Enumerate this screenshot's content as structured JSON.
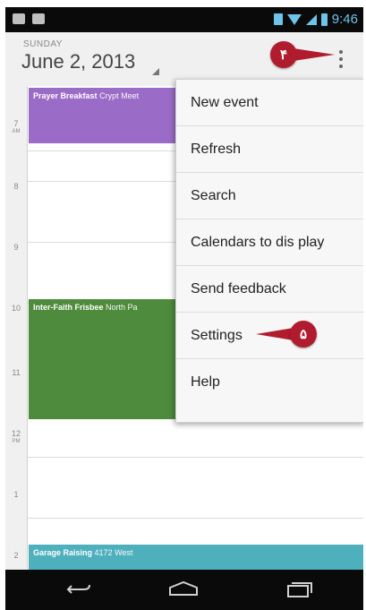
{
  "status_bar": {
    "time": "9:46",
    "icons": [
      "email-icon",
      "game-icon",
      "bluetooth-icon",
      "wifi-icon",
      "signal-icon",
      "battery-icon"
    ]
  },
  "header": {
    "day": "SUNDAY",
    "date": "June 2, 2013"
  },
  "time_labels": [
    {
      "hour": "7",
      "ampm": "AM"
    },
    {
      "hour": "8",
      "ampm": ""
    },
    {
      "hour": "9",
      "ampm": ""
    },
    {
      "hour": "10",
      "ampm": ""
    },
    {
      "hour": "11",
      "ampm": ""
    },
    {
      "hour": "12",
      "ampm": "PM"
    },
    {
      "hour": "1",
      "ampm": ""
    },
    {
      "hour": "2",
      "ampm": ""
    }
  ],
  "events": [
    {
      "title": "Prayer Breakfast",
      "location": "Crypt Meet",
      "color": "#9b6cc7"
    },
    {
      "title": "Inter-Faith Frisbee",
      "location": "North Pa",
      "color": "#4e8b3c"
    },
    {
      "title": "Garage Raising",
      "location": "4172 West",
      "color": "#4fb0bd"
    }
  ],
  "menu": {
    "items": [
      {
        "label": "New event"
      },
      {
        "label": "Refresh"
      },
      {
        "label": "Search"
      },
      {
        "label": "Calendars to dis play"
      },
      {
        "label": "Send feedback"
      },
      {
        "label": "Settings"
      },
      {
        "label": "Help"
      }
    ]
  },
  "callouts": {
    "overflow_marker": "۴",
    "settings_marker": "۵",
    "color": "#b01c2e"
  },
  "nav": {
    "icons": [
      "back-icon",
      "home-icon",
      "recent-apps-icon"
    ]
  }
}
